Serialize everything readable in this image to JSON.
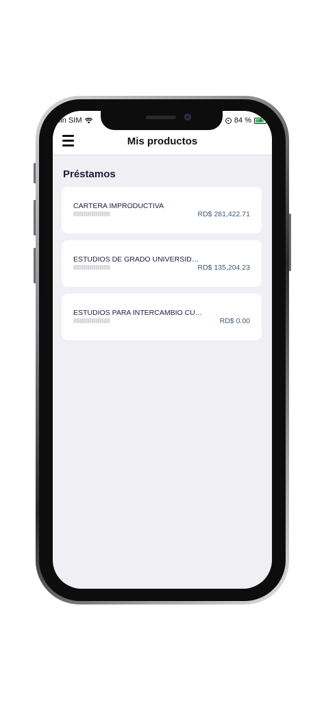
{
  "status_bar": {
    "carrier": "Sin SIM",
    "battery": "84 %"
  },
  "nav": {
    "title": "Mis productos"
  },
  "section": {
    "title": "Préstamos"
  },
  "loans": [
    {
      "name": "CARTERA IMPRODUCTIVA",
      "amount": "RD$ 281,422.71"
    },
    {
      "name": "ESTUDIOS DE GRADO UNIVERSIDAD...",
      "amount": "RD$ 135,204.23"
    },
    {
      "name": "ESTUDIOS PARA INTERCAMBIO CULTURAL...",
      "amount": "RD$ 0.00"
    }
  ],
  "colors": {
    "screen_background": "#efeff4",
    "title_text": "#1f1b3a",
    "amount_text": "#3f5876",
    "battery_fill": "#34c759"
  },
  "icons": [
    "wifi-icon",
    "orientation-lock-icon",
    "battery-charging-icon",
    "hamburger-menu-icon"
  ]
}
